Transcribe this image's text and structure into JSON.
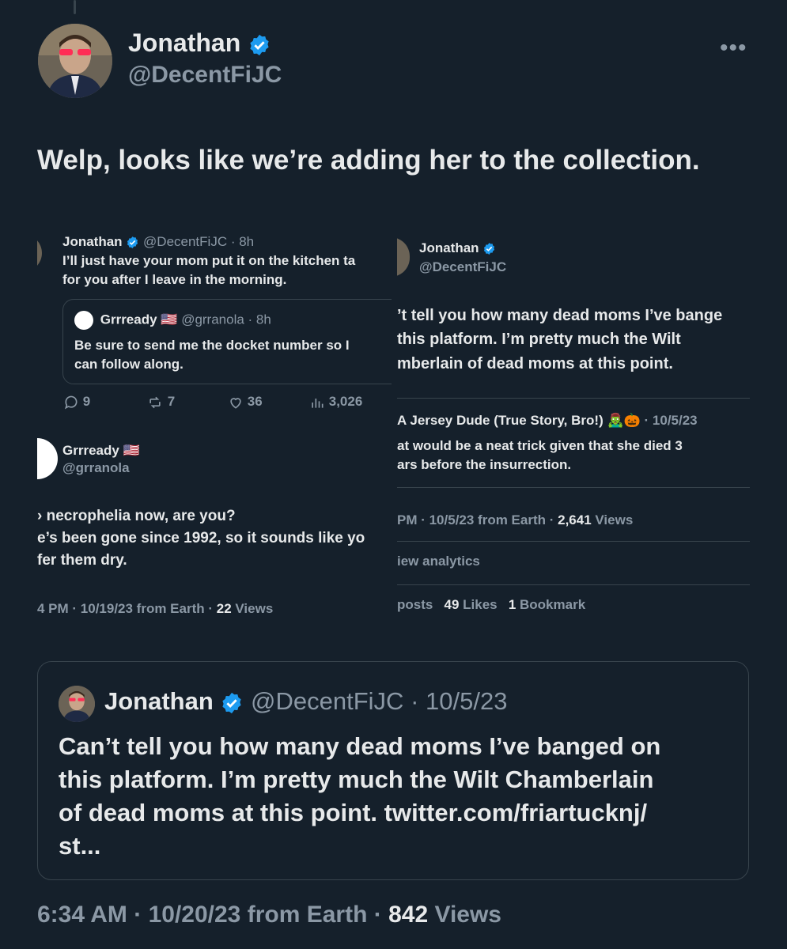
{
  "main": {
    "name": "Jonathan",
    "handle": "@DecentFiJC",
    "text": "Welp, looks like we’re adding her to the collection.",
    "more": "•••",
    "footer": {
      "time": "6:34 AM",
      "date": "10/20/23",
      "source": "from Earth",
      "views_count": "842",
      "views_label": "Views"
    }
  },
  "left_shot": {
    "top_tweet": {
      "name": "Jonathan",
      "handle_time": "@DecentFiJC · 8h",
      "text_line1": "I’ll just have your mom put it on the kitchen ta",
      "text_line2": "for you after I leave in the morning.",
      "quote": {
        "name": "Grrready 🇺🇸",
        "handle_time": "@grranola · 8h",
        "text_line1": "Be sure to send me the docket number so I",
        "text_line2": "can follow along."
      },
      "actions": {
        "replies": "9",
        "reposts": "7",
        "likes": "36",
        "views": "3,026"
      }
    },
    "reply": {
      "name": "Grrready 🇺🇸",
      "handle": "@grranola",
      "text_line1": "› necrophelia now, are you?",
      "text_line2": "e’s been gone since 1992, so it sounds like yo",
      "text_line3": "fer them dry.",
      "meta_prefix": "4 PM · 10/19/23 from Earth · ",
      "views_count": "22",
      "views_label": " Views"
    }
  },
  "right_shot": {
    "name": "Jonathan",
    "handle": "@DecentFiJC",
    "text_line1": "’t tell you how many dead moms I’ve bange",
    "text_line2": "this platform. I’m pretty much the Wilt",
    "text_line3": "mberlain of dead moms at this point.",
    "quoted_author": "A Jersey Dude (True Story, Bro!) 🧟‍♂️🎃",
    "quoted_date": " · 10/5/23",
    "quoted_line1": "at would be a neat trick given that she died 3",
    "quoted_line2": "ars before the insurrection.",
    "meta_prefix": "PM · 10/5/23 from Earth · ",
    "views_count": "2,641",
    "views_label": " Views",
    "analytics": "iew analytics",
    "reposts_label": "posts",
    "likes_count": "49",
    "likes_label": " Likes",
    "bookmark_count": "1",
    "bookmark_label": " Bookmark"
  },
  "quoted_tweet": {
    "name": "Jonathan",
    "handle": "@DecentFiJC",
    "date": "· 10/5/23",
    "text_line1": "Can’t tell you how many dead moms I’ve banged on",
    "text_line2": "this platform. I’m pretty much the Wilt Chamberlain",
    "text_line3": "of dead moms at this point. twitter.com/friartucknj/",
    "text_line4": "st..."
  },
  "colors": {
    "background": "#15202b",
    "text": "#e7e9ea",
    "muted": "#8b98a5",
    "verified": "#1d9bf0",
    "border": "#38444d"
  }
}
